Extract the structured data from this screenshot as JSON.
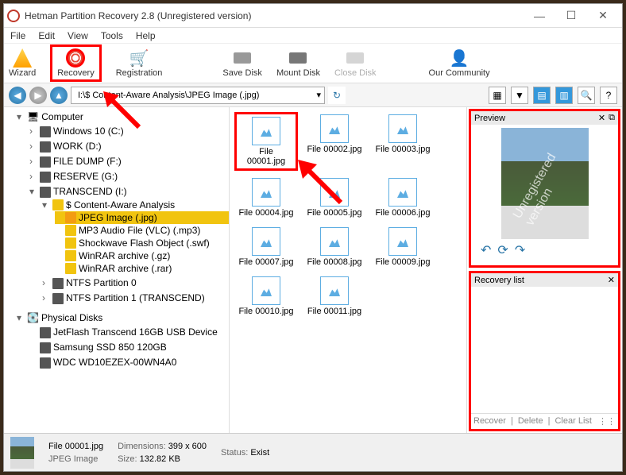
{
  "title": "Hetman Partition Recovery 2.8 (Unregistered version)",
  "menu": {
    "file": "File",
    "edit": "Edit",
    "view": "View",
    "tools": "Tools",
    "help": "Help"
  },
  "toolbar": {
    "wizard": "Wizard",
    "recovery": "Recovery",
    "registration": "Registration",
    "save_disk": "Save Disk",
    "mount_disk": "Mount Disk",
    "close_disk": "Close Disk",
    "community": "Our Community"
  },
  "path": "I:\\$ Content-Aware Analysis\\JPEG Image (.jpg)",
  "tree": {
    "root": "Computer",
    "drives": [
      "Windows 10 (C:)",
      "WORK (D:)",
      "FILE DUMP (F:)",
      "RESERVE (G:)",
      "TRANSCEND (I:)"
    ],
    "content_aware": "$ Content-Aware Analysis",
    "folders": [
      "JPEG Image (.jpg)",
      "MP3 Audio File (VLC) (.mp3)",
      "Shockwave Flash Object (.swf)",
      "WinRAR archive (.gz)",
      "WinRAR archive (.rar)"
    ],
    "ntfs0": "NTFS Partition 0",
    "ntfs1": "NTFS Partition 1 (TRANSCEND)",
    "phys_hdr": "Physical Disks",
    "phys": [
      "JetFlash Transcend 16GB USB Device",
      "Samsung SSD 850 120GB",
      "WDC WD10EZEX-00WN4A0"
    ]
  },
  "files": [
    "File 00001.jpg",
    "File 00002.jpg",
    "File 00003.jpg",
    "File 00004.jpg",
    "File 00005.jpg",
    "File 00006.jpg",
    "File 00007.jpg",
    "File 00008.jpg",
    "File 00009.jpg",
    "File 00010.jpg",
    "File 00011.jpg"
  ],
  "preview": {
    "title": "Preview"
  },
  "recovery_list": {
    "title": "Recovery list",
    "recover": "Recover",
    "delete": "Delete",
    "clear": "Clear List"
  },
  "status": {
    "name": "File 00001.jpg",
    "type": "JPEG Image",
    "dim_label": "Dimensions:",
    "dim": "399 x 600",
    "size_label": "Size:",
    "size": "132.82 KB",
    "stat_label": "Status:",
    "stat": "Exist"
  }
}
